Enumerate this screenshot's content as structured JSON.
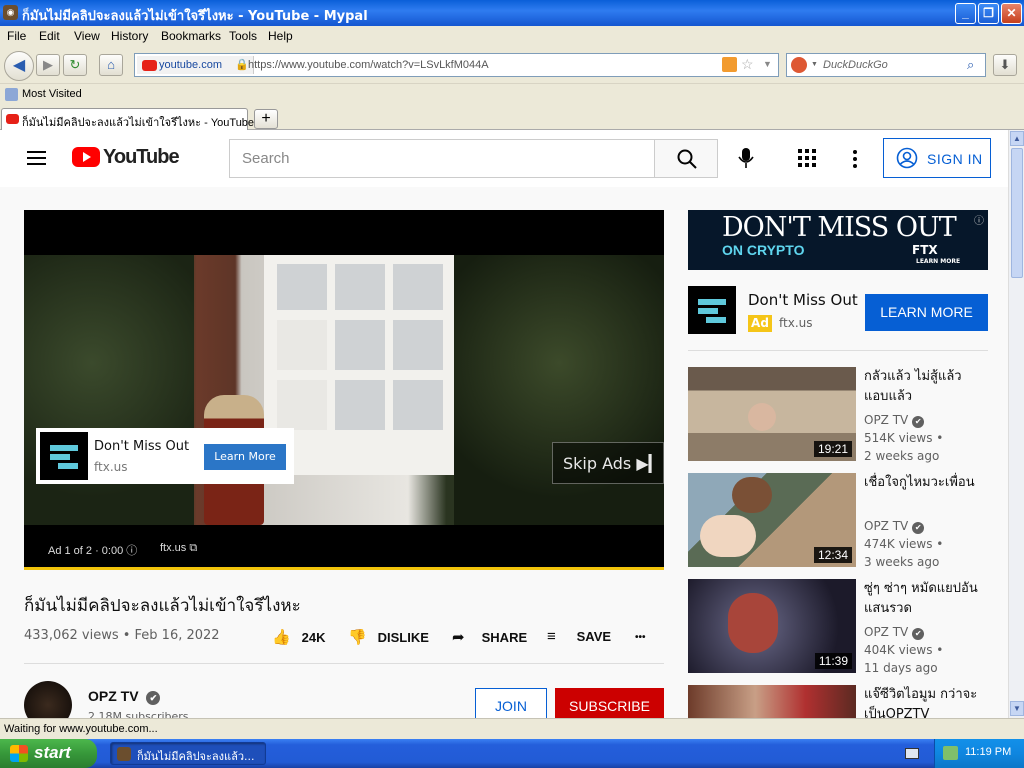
{
  "window": {
    "title": "ก็มันไม่มีคลิปจะลงแล้วไม่เข้าใจรึไงหะ - YouTube - Mypal",
    "buttons": [
      "_",
      "❐",
      "✕"
    ]
  },
  "menu": [
    "File",
    "Edit",
    "View",
    "History",
    "Bookmarks",
    "Tools",
    "Help"
  ],
  "navbar": {
    "site_badge": "youtube.com",
    "url": "https://www.youtube.com/watch?v=LSvLkfM044A",
    "search_placeholder": "DuckDuckGo"
  },
  "bookmarks": [
    "Most Visited"
  ],
  "tabs": [
    {
      "label": "ก็มันไม่มีคลิปจะลงแล้วไม่เข้าใจรึไงหะ - YouTube"
    }
  ],
  "youtube": {
    "search_placeholder": "Search",
    "signin_label": "SIGN IN",
    "logo_text": "YouTube"
  },
  "player": {
    "overlay_ad": {
      "name": "Don't Miss Out",
      "domain": "ftx.us",
      "button": "Learn More"
    },
    "skip_label": "Skip Ads ▶▎",
    "ad_info": "Ad 1 of 2 · 0:00 ⓘ",
    "ad_domain": "ftx.us ⧉",
    "progress": 1.0
  },
  "video": {
    "title": "ก็มันไม่มีคลิปจะลงแล้วไม่เข้าใจรึไงหะ",
    "stats": "433,062 views • Feb 16, 2022",
    "likes": "24K",
    "dislike_label": "DISLIKE",
    "share_label": "SHARE",
    "save_label": "SAVE",
    "more": "•••"
  },
  "channel": {
    "name": "OPZ TV",
    "verified": "✔",
    "subs": "2.18M subscribers",
    "join_label": "JOIN",
    "subscribe_label": "SUBSCRIBE"
  },
  "sidebar": {
    "banner": {
      "headline": "DON'T MISS OUT",
      "sub": "ON CRYPTO",
      "brand": "FTX",
      "cta": "LEARN MORE",
      "info": "ⓘ"
    },
    "ad": {
      "name": "Don't Miss Out",
      "badge": "Ad",
      "domain": "ftx.us",
      "button": "LEARN MORE"
    },
    "recommendations": [
      {
        "title": "กลัวแล้ว ไม่สู้แล้ว แอบแล้ว",
        "channel": "OPZ TV",
        "views": "514K views •",
        "age": "2 weeks ago",
        "duration": "19:21"
      },
      {
        "title": "เชื่อใจกูไหมวะเพื่อน",
        "channel": "OPZ TV",
        "views": "474K views •",
        "age": "3 weeks ago",
        "duration": "12:34"
      },
      {
        "title": "ซู่ๆ ซ่าๆ หมัดแยปอันแสนรวด",
        "channel": "OPZ TV",
        "views": "404K views •",
        "age": "11 days ago",
        "duration": "11:39"
      },
      {
        "title": "แจ๊ซีวิตไอมูม กว่าจะเป็นOPZTV",
        "channel": "",
        "views": "",
        "age": "",
        "duration": ""
      }
    ]
  },
  "status": "Waiting for www.youtube.com...",
  "taskbar": {
    "start": "start",
    "item": "ก็มันไม่มีคลิปจะลงแล้ว...",
    "clock": "11:19 PM"
  }
}
